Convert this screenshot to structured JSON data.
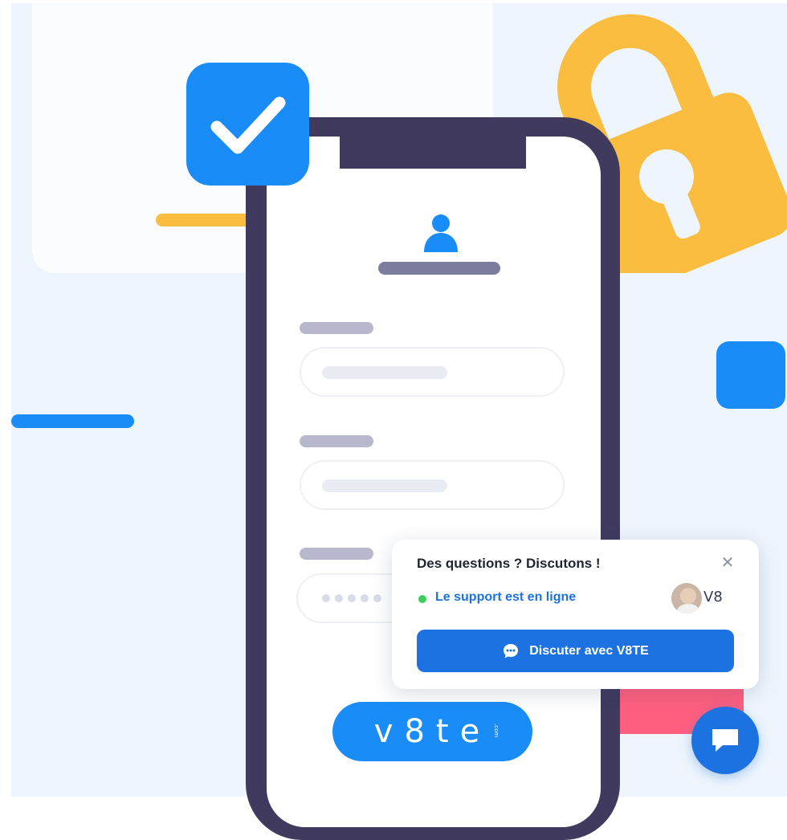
{
  "illustration": {
    "brand_logo": "v8te",
    "brand_tld": ".com",
    "password_dots": 5
  },
  "chat_widget": {
    "title": "Des questions ? Discutons !",
    "close_icon": "close-icon",
    "status": "Le support est en ligne",
    "status_color": "#3ccf5b",
    "brand_mini": "V8",
    "button_label": "Discuter avec V8TE",
    "button_icon": "chat-bubble-icon",
    "accent": "#1c72e0",
    "launcher_icon": "chat-launcher-icon"
  },
  "colors": {
    "primary_blue": "#1a8cf7",
    "phone_frame": "#3f3a5e",
    "lock_yellow": "#fbbd3f",
    "pink": "#ff5f7e"
  }
}
